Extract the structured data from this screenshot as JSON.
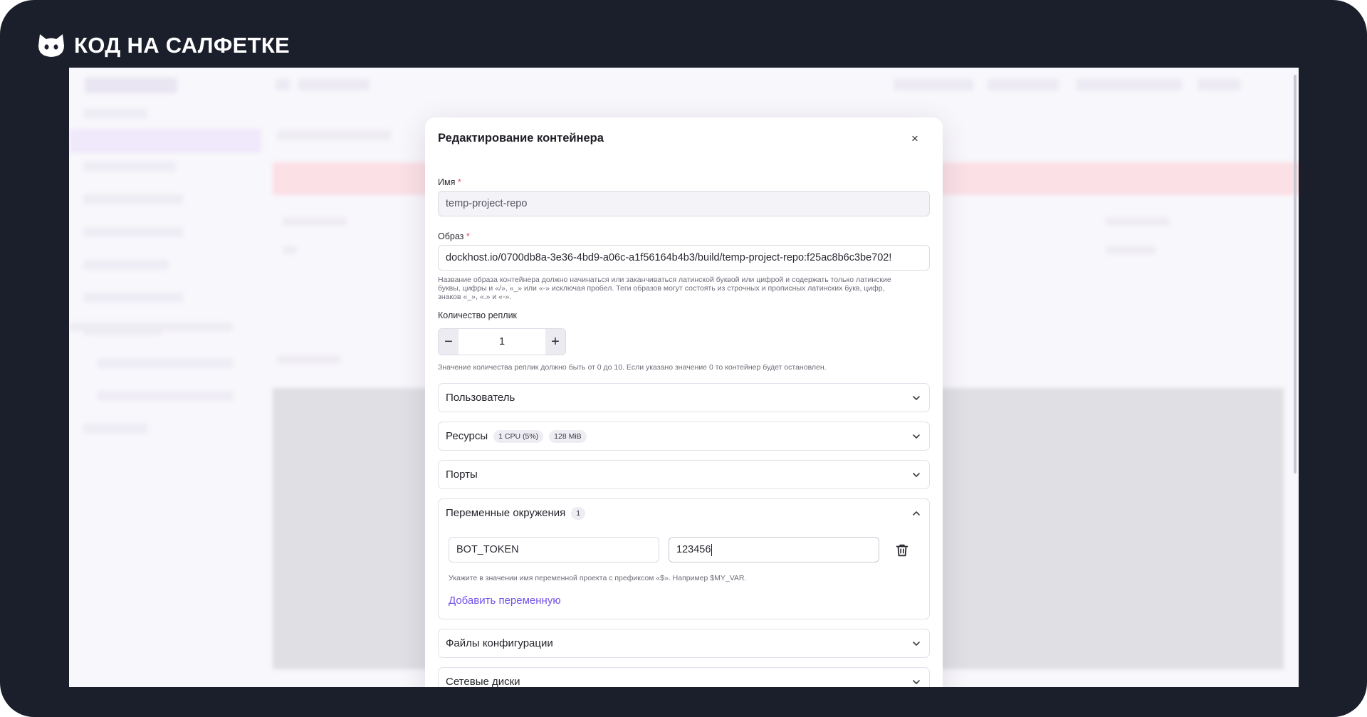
{
  "brand": {
    "name": "КОД НА САЛФЕТКЕ",
    "logo_icon": "cat-head-icon"
  },
  "colors": {
    "frame_bg": "#1b1f2c",
    "accent": "#7352e6",
    "required": "#e34a5b"
  },
  "modal": {
    "title": "Редактирование контейнера",
    "close_label": "×",
    "name": {
      "label": "Имя",
      "required": "*",
      "value": "temp-project-repo"
    },
    "image": {
      "label": "Образ",
      "required": "*",
      "value": "dockhost.io/0700db8a-3e36-4bd9-a06c-a1f56164b4b3/build/temp-project-repo:f25ac8b6c3be702!",
      "hint_1": "Название образа контейнера должно начинаться или заканчиваться латинской буквой или цифрой и содержать только латинские",
      "hint_2": "буквы, цифры и «/», «_» или «-» исключая пробел. Теги образов могут состоять из строчных и прописных латинских букв, цифр,",
      "hint_3": "знаков «_», «.» и «-»."
    },
    "replicas": {
      "label": "Количество реплик",
      "minus": "−",
      "plus": "+",
      "value": "1",
      "hint": "Значение количества реплик должно быть от 0 до 10. Если указано значение 0 то контейнер будет остановлен."
    },
    "sections": {
      "user": {
        "title": "Пользователь"
      },
      "resources": {
        "title": "Ресурсы",
        "badge_cpu": "1 CPU (5%)",
        "badge_mem": "128 MiB"
      },
      "ports": {
        "title": "Порты"
      },
      "env": {
        "title": "Переменные окружения",
        "count": "1",
        "key": "BOT_TOKEN",
        "value": "123456",
        "hint": "Укажите в значении имя переменной проекта с префиксом «$». Например $MY_VAR.",
        "add_label": "Добавить переменную"
      },
      "config": {
        "title": "Файлы конфигурации"
      },
      "disks": {
        "title": "Сетевые диски"
      }
    }
  }
}
